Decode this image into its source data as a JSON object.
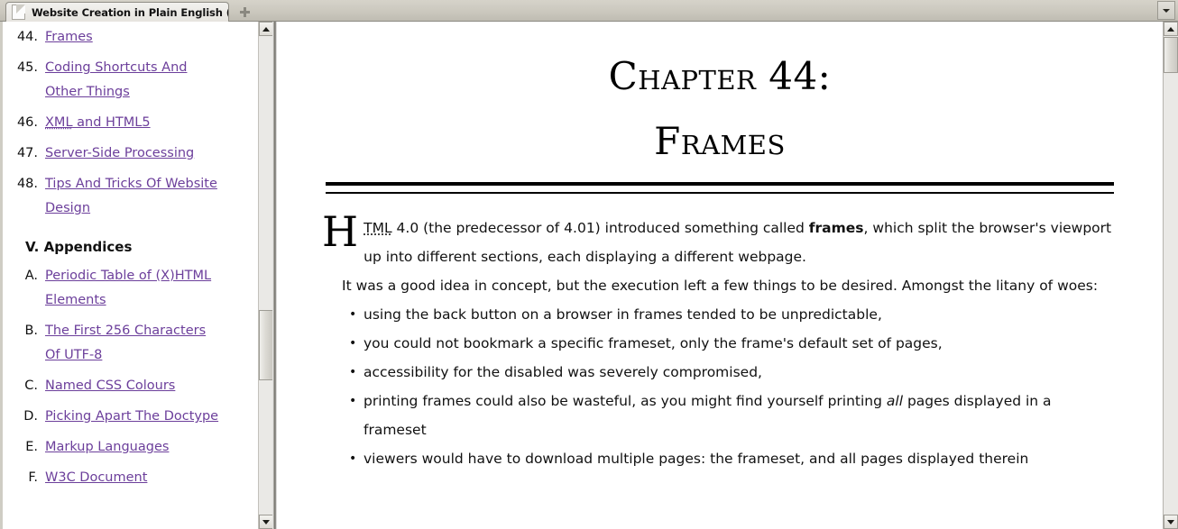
{
  "window": {
    "tab": {
      "title": "Website Creation in Plain English (Fr...",
      "favicon": "page-icon"
    },
    "new_tab_label": "+",
    "tab_list_icon": "chevron-down-icon"
  },
  "sidebar": {
    "chapters": [
      {
        "num": "44.",
        "label": "Frames",
        "abbr": ""
      },
      {
        "num": "45.",
        "label": "Coding Shortcuts And Other Things",
        "abbr": ""
      },
      {
        "num": "46.",
        "label": "XML and HTML5",
        "abbr": "XML"
      },
      {
        "num": "47.",
        "label": "Server-Side Processing",
        "abbr": ""
      },
      {
        "num": "48.",
        "label": "Tips And Tricks Of Website Design",
        "abbr": ""
      }
    ],
    "appendices_heading": "V. Appendices",
    "appendices": [
      {
        "num": "A.",
        "label": "Periodic Table of (X)HTML Elements"
      },
      {
        "num": "B.",
        "label": "The First 256 Characters Of UTF-8"
      },
      {
        "num": "C.",
        "label": "Named CSS Colours"
      },
      {
        "num": "D.",
        "label": "Picking Apart The Doctype"
      },
      {
        "num": "E.",
        "label": "Markup Languages"
      },
      {
        "num": "F.",
        "label": "W3C Document"
      }
    ]
  },
  "article": {
    "title_line1": "Chapter 44:",
    "title_line2": "Frames",
    "dropcap": "H",
    "lead_abbr": "TML",
    "lead_part1": " 4.0 (the predecessor of 4.01) introduced something called ",
    "lead_bold": "frames",
    "lead_part2": ", which split the browser's viewport up into different sections, each displaying a different webpage.",
    "para2": "It was a good idea in concept, but the execution left a few things to be desired. Amongst the litany of woes:",
    "bullets": [
      {
        "text": "using the back button on a browser in frames tended to be unpredictable,"
      },
      {
        "text": "you could not bookmark a specific frameset, only the frame's default set of pages,"
      },
      {
        "text": "accessibility for the disabled was severely compromised,"
      },
      {
        "pre": "printing frames could also be wasteful, as you might find yourself printing ",
        "em": "all",
        "post": " pages displayed in a frameset"
      },
      {
        "text": "viewers would have to download multiple pages: the frameset, and all pages displayed therein"
      }
    ]
  },
  "scrollbars": {
    "up_icon": "triangle-up-icon",
    "down_icon": "triangle-down-icon"
  },
  "colors": {
    "link": "#6c3f9b",
    "text": "#111111",
    "chrome": "#cfcdc4"
  }
}
